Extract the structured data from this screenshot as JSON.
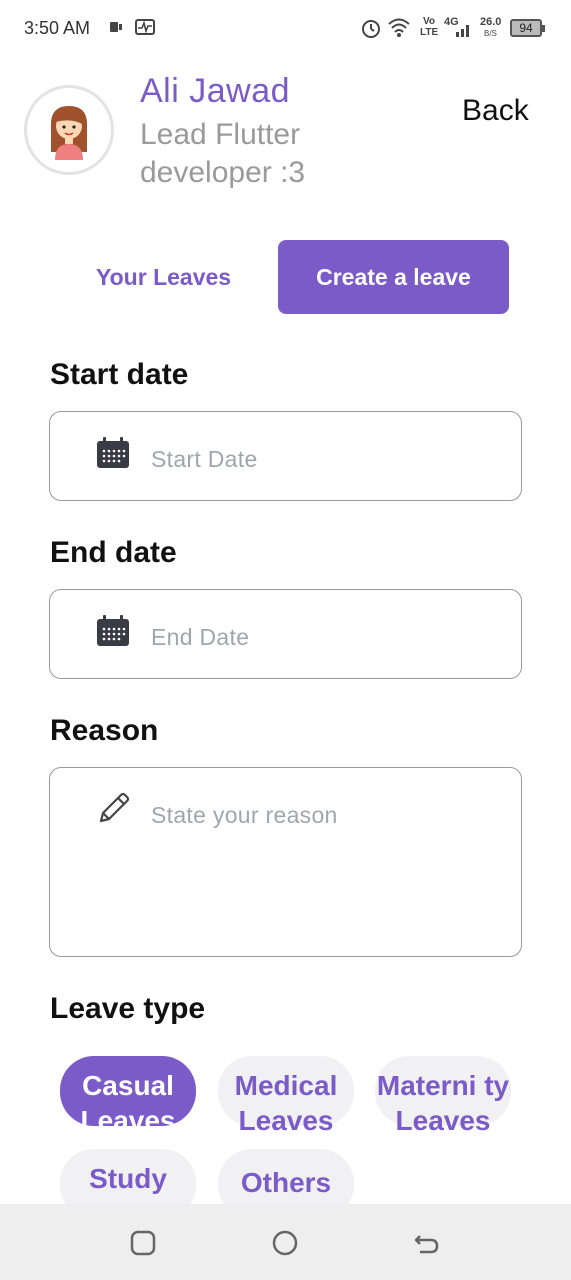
{
  "status_bar": {
    "time": "3:50 AM",
    "network": "4G",
    "speed_value": "26.0",
    "speed_unit": "B/S",
    "volte": "Vo LTE",
    "battery": "94"
  },
  "profile": {
    "name": "Ali Jawad",
    "role": "Lead Flutter developer :3",
    "back_label": "Back"
  },
  "tabs": {
    "your_leaves": "Your Leaves",
    "create_leave": "Create a leave"
  },
  "form": {
    "start_label": "Start date",
    "start_placeholder": "Start Date",
    "end_label": "End date",
    "end_placeholder": "End Date",
    "reason_label": "Reason",
    "reason_placeholder": "State your reason",
    "leave_type_label": "Leave type"
  },
  "leave_types": [
    {
      "label": "Casual Leaves",
      "selected": true
    },
    {
      "label": "Medical Leaves",
      "selected": false
    },
    {
      "label": "Materni ty Leaves",
      "selected": false
    },
    {
      "label": "Study Leaves",
      "selected": false
    },
    {
      "label": "Others",
      "selected": false
    }
  ],
  "colors": {
    "accent": "#7b5bc7",
    "chip_bg": "#f1f1f3",
    "placeholder": "#a0a6ad"
  }
}
